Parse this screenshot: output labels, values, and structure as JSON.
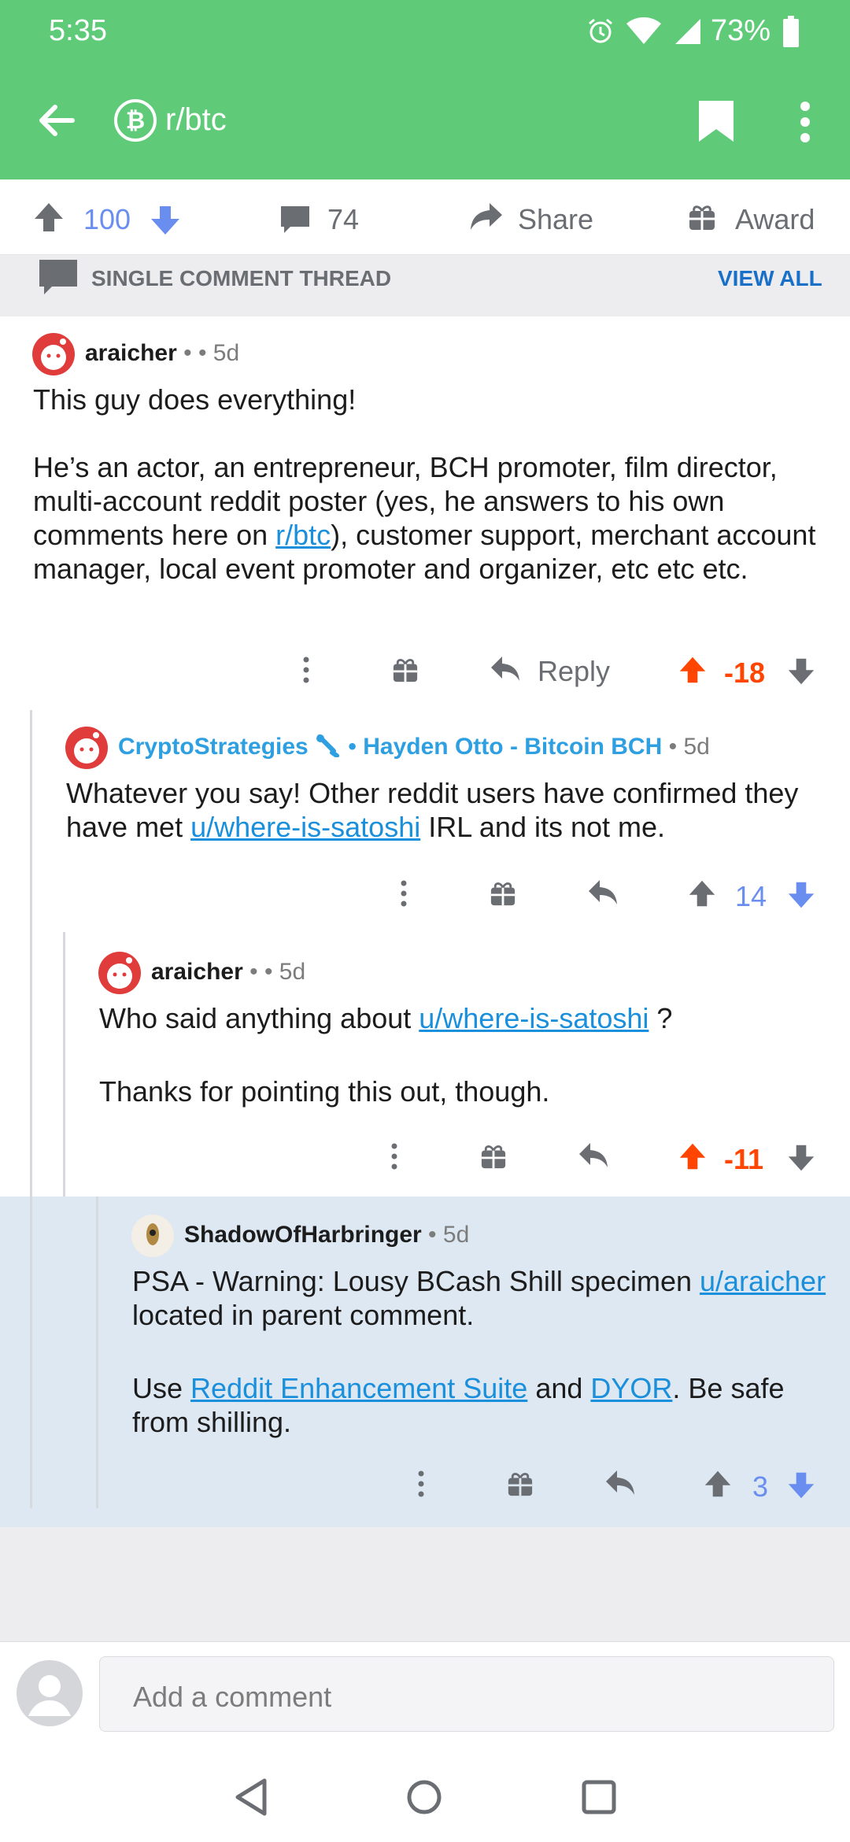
{
  "status": {
    "time": "5:35",
    "battery": "73%"
  },
  "header": {
    "subreddit": "r/btc"
  },
  "post_actions": {
    "upvotes": "100",
    "comments": "74",
    "share": "Share",
    "award": "Award"
  },
  "thread": {
    "title": "SINGLE COMMENT THREAD",
    "view_all": "VIEW ALL"
  },
  "comments": [
    {
      "username": "araicher",
      "sep": "•",
      "time": "• 5d",
      "body_p1": "This guy does everything!",
      "body_p2_pre": "He’s an actor, an entrepreneur, BCH promoter, film director, multi-account reddit poster (yes, he answers to his own comments here on ",
      "body_p2_link": "r/btc",
      "body_p2_post": "), customer support, merchant account manager, local event promoter and organizer, etc etc etc.",
      "reply": "Reply",
      "score": "-18"
    },
    {
      "username": "CryptoStrategies",
      "flair": "• Hayden Otto - Bitcoin BCH",
      "time": "• 5d",
      "body_pre": "Whatever you say! Other reddit users have confirmed they have met ",
      "body_link": "u/where-is-satoshi",
      "body_post": " IRL and its not me.",
      "score": "14"
    },
    {
      "username": "araicher",
      "sep": "•",
      "time": "• 5d",
      "body_p1_pre": "Who said anything about ",
      "body_p1_link": "u/where-is-satoshi",
      "body_p1_post": " ?",
      "body_p2": "Thanks for pointing this out, though.",
      "score": "-11"
    },
    {
      "username": "ShadowOfHarbringer",
      "time": "• 5d",
      "body_p1_pre": "PSA - Warning: Lousy BCash Shill specimen ",
      "body_p1_link": "u/araicher",
      "body_p1_post": " located in parent comment.",
      "body_p2_pre": "Use ",
      "body_p2_link1": "Reddit Enhancement Suite",
      "body_p2_mid": " and ",
      "body_p2_link2": "DYOR",
      "body_p2_post": ". Be safe from shilling.",
      "score": "3"
    }
  ],
  "composer": {
    "placeholder": "Add a comment"
  },
  "colors": {
    "appbar": "#5fcb78",
    "upvoted": "#ff4500",
    "link": "#1a8fdb",
    "downvote": "#6a8ef0",
    "highlight": "#dde8f2"
  },
  "icons": [
    "back-arrow-icon",
    "bitcoin-icon",
    "bookmark-icon",
    "overflow-menu-icon",
    "upvote-icon",
    "downvote-icon",
    "comment-icon",
    "share-icon",
    "award-icon",
    "reply-icon",
    "more-icon",
    "avatar-icon",
    "nav-back-icon",
    "nav-home-icon",
    "nav-recents-icon",
    "alarm-icon",
    "wifi-icon",
    "signal-icon",
    "battery-icon"
  ]
}
